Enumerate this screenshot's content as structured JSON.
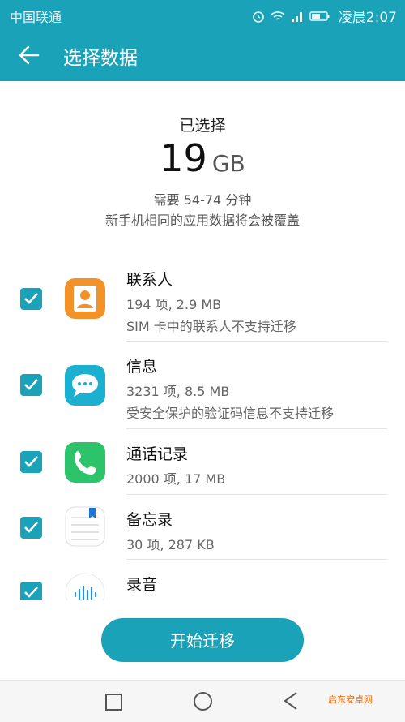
{
  "status_bar": {
    "carrier": "中国联通",
    "time": "凌晨2:07"
  },
  "header": {
    "title": "选择数据",
    "back_icon": "arrow-left-icon"
  },
  "summary": {
    "selected_label": "已选择",
    "size_value": "19",
    "size_unit": "GB",
    "need_time": "需要 54-74 分钟",
    "overwrite_warning": "新手机相同的应用数据将会被覆盖"
  },
  "items": [
    {
      "title": "联系人",
      "detail": "194 项, 2.9 MB",
      "note": "SIM 卡中的联系人不支持迁移",
      "icon": "contacts-icon",
      "color": "#f4922a",
      "checked": true
    },
    {
      "title": "信息",
      "detail": "3231 项, 8.5 MB",
      "note": "受安全保护的验证码信息不支持迁移",
      "icon": "messages-icon",
      "color": "#1bb0cf",
      "checked": true
    },
    {
      "title": "通话记录",
      "detail": "2000 项, 17 MB",
      "icon": "phone-icon",
      "color": "#2dc36a",
      "checked": true
    },
    {
      "title": "备忘录",
      "detail": "30 项, 287 KB",
      "icon": "notepad-icon",
      "color": "#ffffff",
      "checked": true
    },
    {
      "title": "录音",
      "icon": "recorder-icon",
      "color": "#ffffff",
      "checked": true
    }
  ],
  "start_button": {
    "label": "开始迁移"
  },
  "watermark": "启东安卓网",
  "colors": {
    "accent": "#1aa2b8"
  }
}
